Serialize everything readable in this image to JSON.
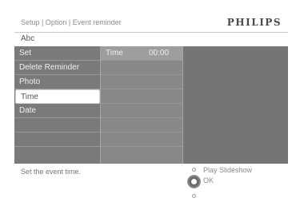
{
  "header": {
    "breadcrumb": "Setup | Option | Event reminder",
    "brand": "PHILIPS"
  },
  "subheader": {
    "text": "Abc"
  },
  "menu": {
    "items": [
      {
        "label": "Set"
      },
      {
        "label": "Delete Reminder"
      },
      {
        "label": "Photo"
      },
      {
        "label": "Time"
      },
      {
        "label": "Date"
      },
      {
        "label": ""
      },
      {
        "label": ""
      },
      {
        "label": ""
      }
    ],
    "selected_index": 3
  },
  "time_field": {
    "label": "Time",
    "value": "00:00"
  },
  "footer": {
    "hint": "Set the event time.",
    "actions": {
      "play": "Play Slideshow",
      "ok": "OK"
    }
  },
  "colors": {
    "panel_bg": "#757575",
    "selected_bg": "#ffffff"
  }
}
